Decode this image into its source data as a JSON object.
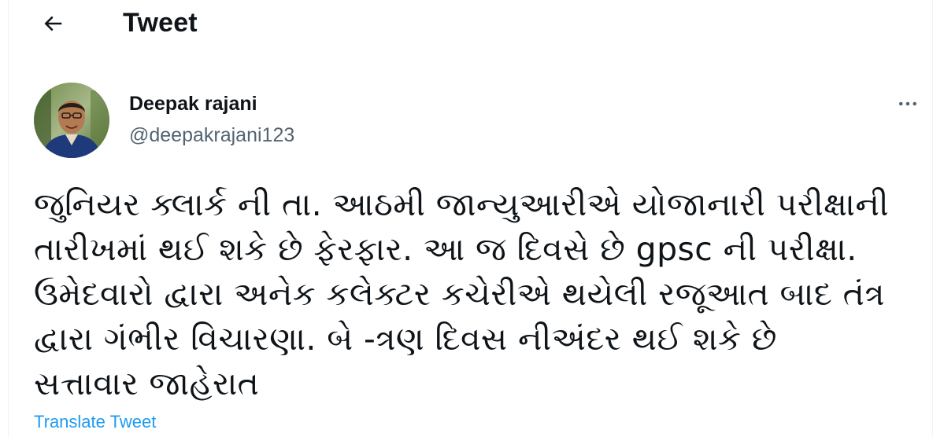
{
  "header": {
    "back_icon": "arrow-left-icon",
    "title": "Tweet"
  },
  "tweet": {
    "author": {
      "name": "Deepak rajani",
      "handle": "@deepakrajani123",
      "avatar": "profile-photo"
    },
    "more_icon": "more-horizontal-icon",
    "text_lines": [
      "જુનિયર ક્લાર્ક ની તા. આઠમી જાન્યુઆરીએ યોજાનારી પરીક્ષાની",
      "તારીખમાં થઈ શકે છે ફેરફાર. આ જ દિવસે છે gpsc ની પરીક્ષા.",
      "ઉમેદવારો દ્વારા અનેક કલેક્ટર કચેરીએ થયેલી રજૂઆત બાદ તંત્ર",
      "દ્વારા ગંભીર વિચારણા. બે -ત્રણ દિવસ નીઅંદર થઈ શકે છે",
      "સત્તાવાર જાહેરાત"
    ],
    "translate_label": "Translate Tweet"
  },
  "colors": {
    "text_primary": "#0f1419",
    "text_secondary": "#536471",
    "link": "#1d9bf0",
    "border": "#eff3f4"
  }
}
